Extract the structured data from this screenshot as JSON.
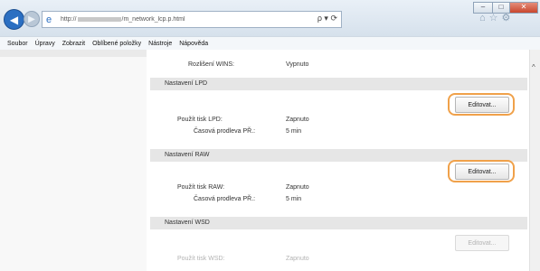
{
  "browser": {
    "address_prefix": "http://",
    "address_suffix": "/m_network_lcp.p.html",
    "address_tools": "ρ ▾ ⟳",
    "menu": [
      "Soubor",
      "Úpravy",
      "Zobrazit",
      "Oblíbené položky",
      "Nástroje",
      "Nápověda"
    ]
  },
  "page": {
    "wins_label": "Rozlišení WINS:",
    "wins_value": "Vypnuto",
    "lpd": {
      "header": "Nastavení LPD",
      "edit_label": "Editovat...",
      "rows": [
        {
          "label": "Použít tisk LPD:",
          "value": "Zapnuto"
        },
        {
          "label": "Časová prodleva PŘ.:",
          "value": "5 min"
        }
      ]
    },
    "raw": {
      "header": "Nastavení RAW",
      "edit_label": "Editovat...",
      "rows": [
        {
          "label": "Použít tisk RAW:",
          "value": "Zapnuto"
        },
        {
          "label": "Časová prodleva PŘ.:",
          "value": "5 min"
        }
      ]
    },
    "wsd": {
      "header": "Nastavení WSD",
      "edit_label": "Editovat...",
      "rows": [
        {
          "label": "Použít tisk WSD:",
          "value": "Zapnuto"
        }
      ]
    }
  },
  "colors": {
    "highlight": "#f0a14a",
    "back_button": "#2b6fc2"
  }
}
